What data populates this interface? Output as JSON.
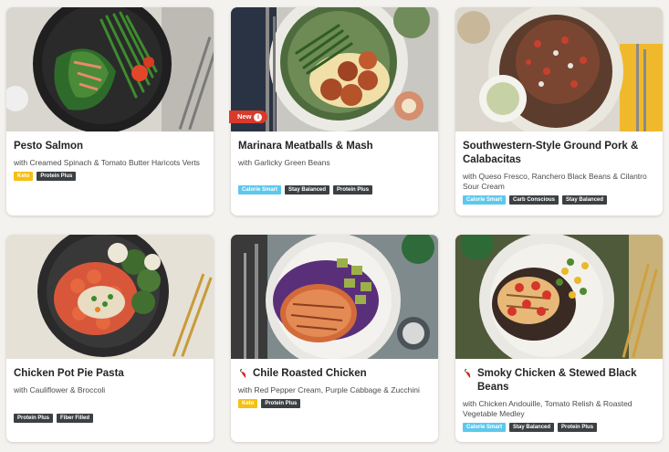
{
  "colors": {
    "page_background": "#f4f2ee",
    "keto_tag": "#f6c012",
    "calorie_smart_tag": "#5cc8ee",
    "dark_tag": "#3c4043",
    "new_badge": "#d93a2b"
  },
  "cards": [
    {
      "title": "Pesto Salmon",
      "subtitle": "with Creamed Spinach & Tomato Butter Haricots Verts",
      "tags": [
        "Keto",
        "Protein Plus"
      ],
      "spicy": false
    },
    {
      "title": "Marinara Meatballs & Mash",
      "subtitle": "with Garlicky Green Beans",
      "tags": [
        "Calorie Smart",
        "Stay Balanced",
        "Protein Plus"
      ],
      "badge": "New",
      "badge_icon": "info-icon",
      "spicy": false
    },
    {
      "title": "Southwestern-Style Ground Pork & Calabacitas",
      "subtitle": "with Queso Fresco, Ranchero Black Beans & Cilantro Sour Cream",
      "tags": [
        "Calorie Smart",
        "Carb Conscious",
        "Stay Balanced"
      ],
      "spicy": false
    },
    {
      "title": "Chicken Pot Pie Pasta",
      "subtitle": "with Cauliflower & Broccoli",
      "tags": [
        "Protein Plus",
        "Fiber Filled"
      ],
      "spicy": false
    },
    {
      "title": "Chile Roasted Chicken",
      "subtitle": "with Red Pepper Cream, Purple Cabbage & Zucchini",
      "tags": [
        "Keto",
        "Protein Plus"
      ],
      "spicy": true,
      "spicy_icon": "chili-pepper-icon"
    },
    {
      "title": "Smoky Chicken & Stewed Black Beans",
      "subtitle": "with Chicken Andouille, Tomato Relish & Roasted Vegetable Medley",
      "tags": [
        "Calorie Smart",
        "Stay Balanced",
        "Protein Plus"
      ],
      "spicy": true,
      "spicy_icon": "chili-pepper-icon"
    }
  ]
}
